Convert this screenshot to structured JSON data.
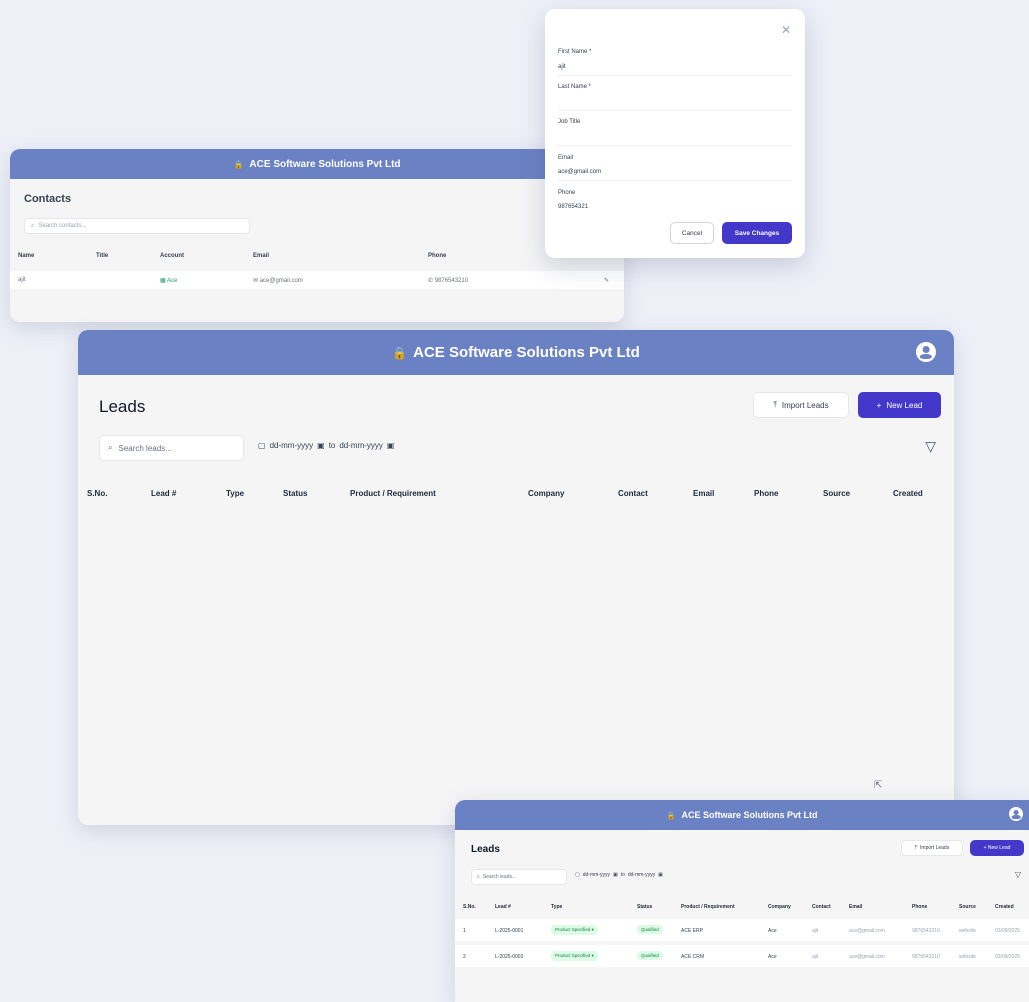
{
  "company": "ACE Software Solutions Pvt Ltd",
  "colors": {
    "header": "#6a82c4",
    "primary": "#4338ca",
    "badge_green": "#15803d"
  },
  "contacts": {
    "title": "Contacts",
    "search_placeholder": "Search contacts...",
    "columns": [
      "Name",
      "Title",
      "Account",
      "Email",
      "Phone"
    ],
    "row": {
      "name": "ajit",
      "title": "",
      "account": "Ace",
      "email": "ace@gmail.com",
      "phone": "9876543210"
    }
  },
  "modal": {
    "first_name_label": "First Name *",
    "first_name_value": "ajit",
    "last_name_label": "Last Name *",
    "last_name_value": "",
    "job_title_label": "Job Title",
    "job_title_value": "",
    "email_label": "Email",
    "email_value": "ace@gmail.com",
    "phone_label": "Phone",
    "phone_value": "987654321",
    "cancel_label": "Cancel",
    "save_label": "Save Changes"
  },
  "leads": {
    "title": "Leads",
    "import_label": "Import Leads",
    "new_label": "New Lead",
    "search_placeholder": "Search leads...",
    "date_from": "dd-mm-yyyy",
    "date_sep": "to",
    "date_to": "dd-mm-yyyy",
    "columns": [
      "S.No.",
      "Lead #",
      "Type",
      "Status",
      "Product / Requirement",
      "Company",
      "Contact",
      "Email",
      "Phone",
      "Source",
      "Created"
    ]
  },
  "leads_small": {
    "title": "Leads",
    "import_label": "Import Leads",
    "new_label": "+ New Lead",
    "search_placeholder": "Search leads...",
    "date_from": "dd-mm-yyyy",
    "date_sep": "to",
    "date_to": "dd-mm-yyyy",
    "columns": [
      "S.No.",
      "Lead #",
      "Type",
      "Status",
      "Product / Requirement",
      "Company",
      "Contact",
      "Email",
      "Phone",
      "Source",
      "Created"
    ],
    "rows": [
      {
        "sno": "1",
        "lead": "L-2025-0001",
        "type": "Product Specified",
        "status": "Qualified",
        "product": "ACE ERP",
        "company": "Ace",
        "contact": "ajit",
        "email": "ace@gmail.com",
        "phone": "9876543210",
        "source": "website",
        "created": "03/09/2025"
      },
      {
        "sno": "2",
        "lead": "L-2025-0002",
        "type": "Product Specified",
        "status": "Qualified",
        "product": "ACE CRM",
        "company": "Ace",
        "contact": "ajit",
        "email": "ace@gmail.com",
        "phone": "9876543210",
        "source": "website",
        "created": "03/09/2025"
      }
    ]
  }
}
